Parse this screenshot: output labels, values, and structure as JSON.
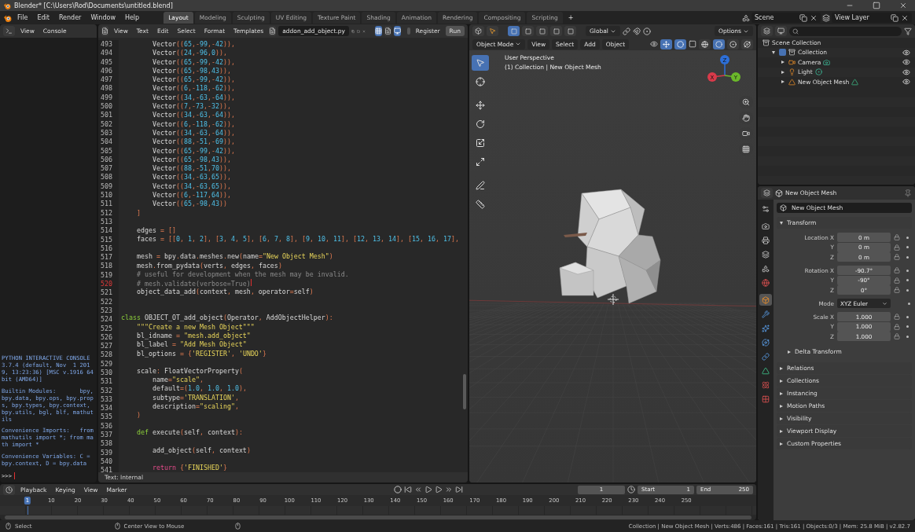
{
  "window": {
    "title": "Blender* [C:\\Users\\Rod\\Documents\\untitled.blend]"
  },
  "menu": [
    "File",
    "Edit",
    "Render",
    "Window",
    "Help"
  ],
  "workspaces": [
    {
      "label": "Layout",
      "selected": true
    },
    {
      "label": "Modeling",
      "selected": false
    },
    {
      "label": "Sculpting",
      "selected": false
    },
    {
      "label": "UV Editing",
      "selected": false
    },
    {
      "label": "Texture Paint",
      "selected": false
    },
    {
      "label": "Shading",
      "selected": false
    },
    {
      "label": "Animation",
      "selected": false
    },
    {
      "label": "Rendering",
      "selected": false
    },
    {
      "label": "Compositing",
      "selected": false
    },
    {
      "label": "Scripting",
      "selected": false
    }
  ],
  "add_workspace": "+",
  "scene": {
    "value": "Scene"
  },
  "view_layer": {
    "value": "View Layer"
  },
  "console": {
    "menu": [
      "View",
      "Console"
    ],
    "output": [
      "PYTHON INTERACTIVE CONSOLE 3.7.4 (default, Nov  1 2019, 13:23:36) [MSC v.1916 64 bit (AMD64)]",
      "Builtin Modules:       bpy, bpy.data, bpy.ops, bpy.props, bpy.types, bpy.context, bpy.utils, bgl, blf, mathutils",
      "Convenience Imports:   from mathutils import *; from math import *",
      "Convenience Variables: C = bpy.context, D = bpy.data"
    ],
    "prompt": ">>>"
  },
  "text_editor": {
    "menu": [
      "View",
      "Text",
      "Edit",
      "Select",
      "Format",
      "Templates"
    ],
    "file": "addon_add_object.py",
    "register": {
      "label": "Register",
      "checked": false
    },
    "run": "Run",
    "footer": "Text: Internal",
    "lines": [
      {
        "num": "493",
        "current": false,
        "parts": [
          {
            "text": "        Vector((65,-99,-42)),",
            "kind": "code"
          }
        ]
      },
      {
        "num": "494",
        "current": false,
        "parts": [
          {
            "text": "        Vector((24,-96,0)),",
            "kind": "code"
          }
        ]
      },
      {
        "num": "495",
        "current": false,
        "parts": [
          {
            "text": "        Vector((65,-99,-42)),",
            "kind": "code"
          }
        ]
      },
      {
        "num": "496",
        "current": false,
        "parts": [
          {
            "text": "        Vector((65,-98,43)),",
            "kind": "code"
          }
        ]
      },
      {
        "num": "497",
        "current": false,
        "parts": [
          {
            "text": "        Vector((65,-99,-42)),",
            "kind": "code"
          }
        ]
      },
      {
        "num": "498",
        "current": false,
        "parts": [
          {
            "text": "        Vector((6,-118,-62)),",
            "kind": "code"
          }
        ]
      },
      {
        "num": "499",
        "current": false,
        "parts": [
          {
            "text": "        Vector((34,-63,-64)),",
            "kind": "code"
          }
        ]
      },
      {
        "num": "500",
        "current": false,
        "parts": [
          {
            "text": "        Vector((7,-73,-32)),",
            "kind": "code"
          }
        ]
      },
      {
        "num": "501",
        "current": false,
        "parts": [
          {
            "text": "        Vector((34,-63,-64)),",
            "kind": "code"
          }
        ]
      },
      {
        "num": "502",
        "current": false,
        "parts": [
          {
            "text": "        Vector((6,-118,-62)),",
            "kind": "code"
          }
        ]
      },
      {
        "num": "503",
        "current": false,
        "parts": [
          {
            "text": "        Vector((34,-63,-64)),",
            "kind": "code"
          }
        ]
      },
      {
        "num": "504",
        "current": false,
        "parts": [
          {
            "text": "        Vector((88,-51,-69)),",
            "kind": "code"
          }
        ]
      },
      {
        "num": "505",
        "current": false,
        "parts": [
          {
            "text": "        Vector((65,-99,-42)),",
            "kind": "code"
          }
        ]
      },
      {
        "num": "506",
        "current": false,
        "parts": [
          {
            "text": "        Vector((65,-98,43)),",
            "kind": "code"
          }
        ]
      },
      {
        "num": "507",
        "current": false,
        "parts": [
          {
            "text": "        Vector((88,-51,70)),",
            "kind": "code"
          }
        ]
      },
      {
        "num": "508",
        "current": false,
        "parts": [
          {
            "text": "        Vector((34,-63,65)),",
            "kind": "code"
          }
        ]
      },
      {
        "num": "509",
        "current": false,
        "parts": [
          {
            "text": "        Vector((34,-63,65)),",
            "kind": "code"
          }
        ]
      },
      {
        "num": "510",
        "current": false,
        "parts": [
          {
            "text": "        Vector((6,-117,64)),",
            "kind": "code"
          }
        ]
      },
      {
        "num": "511",
        "current": false,
        "parts": [
          {
            "text": "        Vector((65,-98,43))",
            "kind": "code"
          }
        ]
      },
      {
        "num": "512",
        "current": false,
        "parts": [
          {
            "text": "    ]",
            "kind": "code"
          }
        ]
      },
      {
        "num": "513",
        "current": false
      },
      {
        "num": "514",
        "current": false,
        "parts": [
          {
            "text": "    edges = []",
            "kind": "code"
          }
        ]
      },
      {
        "num": "515",
        "current": false,
        "parts": [
          {
            "text": "    faces = [[0, 1, 2], [3, 4, 5], [6, 7, 8], [9, 10, 11], [12, 13, 14], [15, 16, 17],",
            "kind": "code"
          }
        ]
      },
      {
        "num": "516",
        "current": false
      },
      {
        "num": "517",
        "current": false,
        "parts": [
          {
            "text": "    mesh = bpy.data.meshes.new(name=\"New Object Mesh\")",
            "kind": "code"
          }
        ]
      },
      {
        "num": "518",
        "current": false,
        "parts": [
          {
            "text": "    mesh.from_pydata(verts, edges, faces)",
            "kind": "code"
          }
        ]
      },
      {
        "num": "519",
        "current": false,
        "parts": [
          {
            "text": "    # useful for development when the mesh may be invalid.",
            "kind": "comment"
          }
        ]
      },
      {
        "num": "520",
        "current": true,
        "parts": [
          {
            "text": "    # mesh.validate(verbose=True)",
            "kind": "comment"
          }
        ]
      },
      {
        "num": "521",
        "current": false,
        "parts": [
          {
            "text": "    object_data_add(context, mesh, operator=self)",
            "kind": "code"
          }
        ]
      },
      {
        "num": "522",
        "current": false
      },
      {
        "num": "523",
        "current": false
      },
      {
        "num": "524",
        "current": false,
        "parts": [
          {
            "text": "class",
            "kind": "keyword"
          },
          {
            "text": " OBJECT_OT_add_object(Operator, AddObjectHelper):",
            "kind": "code"
          }
        ]
      },
      {
        "num": "525",
        "current": false,
        "parts": [
          {
            "text": "    \"\"\"Create a new Mesh Object\"\"\"",
            "kind": "string"
          }
        ]
      },
      {
        "num": "526",
        "current": false,
        "parts": [
          {
            "text": "    bl_idname = \"mesh.add_object\"",
            "kind": "code"
          }
        ]
      },
      {
        "num": "527",
        "current": false,
        "parts": [
          {
            "text": "    bl_label = \"Add Mesh Object\"",
            "kind": "code"
          }
        ]
      },
      {
        "num": "528",
        "current": false,
        "parts": [
          {
            "text": "    bl_options = {'REGISTER', 'UNDO'}",
            "kind": "code"
          }
        ]
      },
      {
        "num": "529",
        "current": false
      },
      {
        "num": "530",
        "current": false,
        "parts": [
          {
            "text": "    scale: FloatVectorProperty(",
            "kind": "code"
          }
        ]
      },
      {
        "num": "531",
        "current": false,
        "parts": [
          {
            "text": "        name=\"scale\",",
            "kind": "code"
          }
        ]
      },
      {
        "num": "532",
        "current": false,
        "parts": [
          {
            "text": "        default=(1.0, 1.0, 1.0),",
            "kind": "code"
          }
        ]
      },
      {
        "num": "533",
        "current": false,
        "parts": [
          {
            "text": "        subtype='TRANSLATION',",
            "kind": "code"
          }
        ]
      },
      {
        "num": "534",
        "current": false,
        "parts": [
          {
            "text": "        description=\"scaling\",",
            "kind": "code"
          }
        ]
      },
      {
        "num": "535",
        "current": false,
        "parts": [
          {
            "text": "    )",
            "kind": "code"
          }
        ]
      },
      {
        "num": "536",
        "current": false
      },
      {
        "num": "537",
        "current": false,
        "parts": [
          {
            "text": "    def",
            "kind": "keyword"
          },
          {
            "text": " execute(self, context):",
            "kind": "code"
          }
        ]
      },
      {
        "num": "538",
        "current": false
      },
      {
        "num": "539",
        "current": false,
        "parts": [
          {
            "text": "        add_object(self, context)",
            "kind": "code"
          }
        ]
      },
      {
        "num": "540",
        "current": false
      },
      {
        "num": "541",
        "current": false,
        "parts": [
          {
            "text": "        return",
            "kind": "reserved"
          },
          {
            "text": " {'FINISHED'}",
            "kind": "code"
          }
        ]
      }
    ]
  },
  "viewport": {
    "orientation": "Global",
    "options": "Options",
    "mode": "Object Mode",
    "menu": [
      "View",
      "Select",
      "Add",
      "Object"
    ],
    "tools": [
      {
        "kind": "select",
        "selected": true
      },
      {
        "kind": "cursor",
        "selected": false
      },
      {
        "kind": "move",
        "selected": false
      },
      {
        "kind": "rotate",
        "selected": false
      },
      {
        "kind": "scale",
        "selected": false
      },
      {
        "kind": "transform",
        "selected": false
      },
      {
        "kind": "annotate",
        "selected": false
      },
      {
        "kind": "measure",
        "selected": false
      }
    ],
    "shading": [
      {
        "kind": "wireframe",
        "selected": false
      },
      {
        "kind": "solid",
        "selected": true
      },
      {
        "kind": "material",
        "selected": false
      },
      {
        "kind": "rendered",
        "selected": false
      }
    ],
    "overlay_text": [
      "User Perspective",
      "(1) Collection | New Object Mesh"
    ],
    "gizmo": [
      "X",
      "Y",
      "Z"
    ]
  },
  "outliner": {
    "tree": [
      {
        "label": "Scene Collection",
        "kind": "scene",
        "children": [
          {
            "label": "Collection",
            "kind": "collection",
            "expanded": true,
            "checked": true,
            "children": [
              {
                "label": "Camera",
                "kind": "camera",
                "expanded": false
              },
              {
                "label": "Light",
                "kind": "light",
                "expanded": false
              },
              {
                "label": "New Object Mesh",
                "kind": "mesh",
                "expanded": false
              }
            ]
          }
        ]
      }
    ]
  },
  "properties": {
    "object_name": "New Object Mesh",
    "name_field": "New Object Mesh",
    "tabs": [
      {
        "kind": "tool",
        "selected": false
      },
      {
        "kind": "render",
        "selected": false
      },
      {
        "kind": "output",
        "selected": false
      },
      {
        "kind": "view_layer",
        "selected": false
      },
      {
        "kind": "scene",
        "selected": false
      },
      {
        "kind": "world",
        "selected": false
      },
      {
        "kind": "object",
        "selected": true
      },
      {
        "kind": "modifier",
        "selected": false
      },
      {
        "kind": "particles",
        "selected": false
      },
      {
        "kind": "physics",
        "selected": false
      },
      {
        "kind": "constraint",
        "selected": false
      },
      {
        "kind": "data",
        "selected": false
      },
      {
        "kind": "material",
        "selected": false
      },
      {
        "kind": "texture",
        "selected": false
      }
    ],
    "transform": {
      "label": "Transform",
      "expanded": true,
      "groups": [
        [
          {
            "label": "Location X",
            "value": "0 m",
            "kind": "number"
          },
          {
            "label": "Y",
            "value": "0 m",
            "kind": "number"
          },
          {
            "label": "Z",
            "value": "0 m",
            "kind": "number"
          }
        ],
        [
          {
            "label": "Rotation X",
            "value": "-90.7°",
            "kind": "number"
          },
          {
            "label": "Y",
            "value": "-90°",
            "kind": "number"
          },
          {
            "label": "Z",
            "value": "0°",
            "kind": "number"
          }
        ],
        [
          {
            "label": "Mode",
            "value": "XYZ Euler",
            "kind": "dropdown"
          }
        ],
        [
          {
            "label": "Scale X",
            "value": "1.000",
            "kind": "number"
          },
          {
            "label": "Y",
            "value": "1.000",
            "kind": "number"
          },
          {
            "label": "Z",
            "value": "1.000",
            "kind": "number"
          }
        ]
      ],
      "subpanel": {
        "label": "Delta Transform",
        "expanded": false
      }
    },
    "panels": [
      {
        "label": "Relations",
        "expanded": false
      },
      {
        "label": "Collections",
        "expanded": false
      },
      {
        "label": "Instancing",
        "expanded": false
      },
      {
        "label": "Motion Paths",
        "expanded": false
      },
      {
        "label": "Visibility",
        "expanded": false
      },
      {
        "label": "Viewport Display",
        "expanded": false
      },
      {
        "label": "Custom Properties",
        "expanded": false
      }
    ]
  },
  "timeline": {
    "menu": [
      "Playback",
      "Keying",
      "View",
      "Marker"
    ],
    "current_frame": "1",
    "start": {
      "label": "Start",
      "value": "1"
    },
    "end": {
      "label": "End",
      "value": "250"
    },
    "ticks": [
      {
        "label": "1",
        "selected": true
      },
      {
        "label": "10",
        "selected": false
      },
      {
        "label": "20",
        "selected": false
      },
      {
        "label": "30",
        "selected": false
      },
      {
        "label": "40",
        "selected": false
      },
      {
        "label": "50",
        "selected": false
      },
      {
        "label": "60",
        "selected": false
      },
      {
        "label": "70",
        "selected": false
      },
      {
        "label": "80",
        "selected": false
      },
      {
        "label": "90",
        "selected": false
      },
      {
        "label": "100",
        "selected": false
      },
      {
        "label": "110",
        "selected": false
      },
      {
        "label": "120",
        "selected": false
      },
      {
        "label": "130",
        "selected": false
      },
      {
        "label": "140",
        "selected": false
      },
      {
        "label": "150",
        "selected": false
      },
      {
        "label": "160",
        "selected": false
      },
      {
        "label": "170",
        "selected": false
      },
      {
        "label": "180",
        "selected": false
      },
      {
        "label": "190",
        "selected": false
      },
      {
        "label": "200",
        "selected": false
      },
      {
        "label": "210",
        "selected": false
      },
      {
        "label": "220",
        "selected": false
      },
      {
        "label": "230",
        "selected": false
      },
      {
        "label": "240",
        "selected": false
      },
      {
        "label": "250",
        "selected": false
      }
    ]
  },
  "status_bar": {
    "hints": [
      "Select",
      "Center View to Mouse"
    ],
    "stats": "Collection | New Object Mesh | Verts:486 | Faces:161 | Tris:161 | Objects:0/3 | Mem: 25.8 MiB | v2.82.7"
  }
}
